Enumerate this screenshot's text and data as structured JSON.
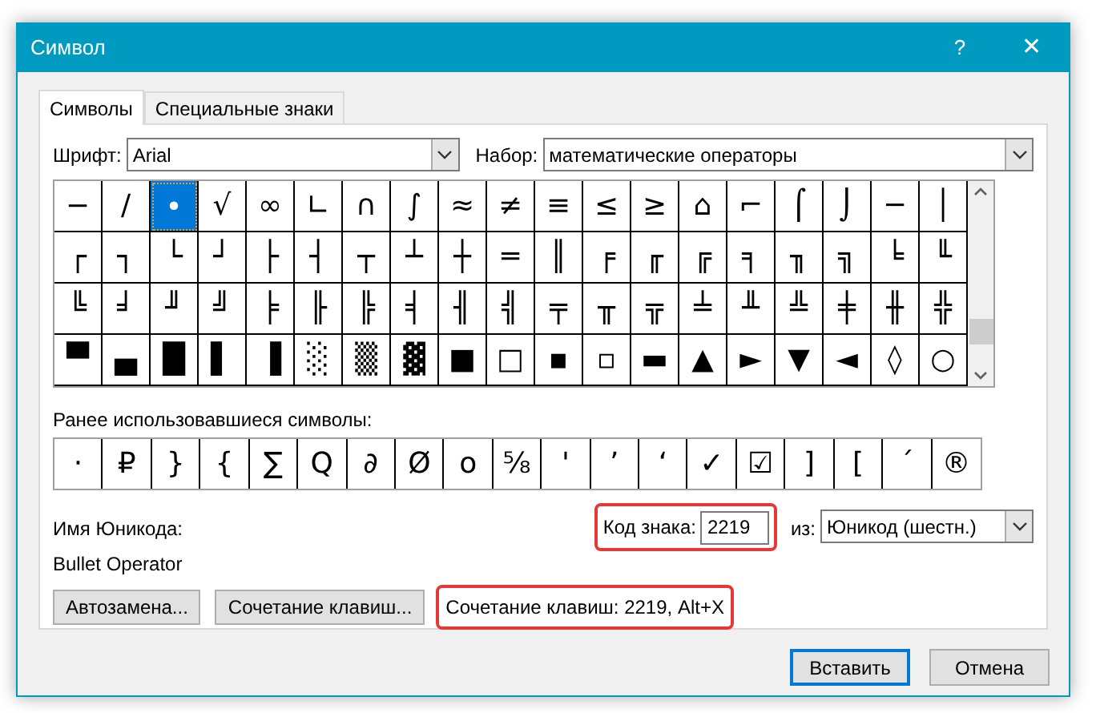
{
  "window": {
    "title": "Символ",
    "help": "?",
    "close": "✕"
  },
  "tabs": [
    {
      "label": "Символы",
      "selected": true
    },
    {
      "label": "Специальные знаки",
      "selected": false
    }
  ],
  "font": {
    "label": "Шрифт:",
    "value": "Arial"
  },
  "subset": {
    "label": "Набор:",
    "value": "математические операторы"
  },
  "symbols": [
    [
      {
        "char": "−",
        "selected": false
      },
      {
        "char": "∕",
        "selected": false
      },
      {
        "char": "∙",
        "selected": true
      },
      {
        "char": "√",
        "selected": false
      },
      {
        "char": "∞",
        "selected": false
      },
      {
        "char": "∟",
        "selected": false
      },
      {
        "char": "∩",
        "selected": false
      },
      {
        "char": "∫",
        "selected": false
      },
      {
        "char": "≈",
        "selected": false
      },
      {
        "char": "≠",
        "selected": false
      },
      {
        "char": "≡",
        "selected": false
      },
      {
        "char": "≤",
        "selected": false
      },
      {
        "char": "≥",
        "selected": false
      },
      {
        "char": "⌂",
        "selected": false
      },
      {
        "char": "⌐",
        "selected": false
      },
      {
        "char": "⌠",
        "selected": false
      },
      {
        "char": "⌡",
        "selected": false
      },
      {
        "char": "─",
        "selected": false
      },
      {
        "char": "│",
        "selected": false
      }
    ],
    [
      {
        "char": "┌",
        "selected": false
      },
      {
        "char": "┐",
        "selected": false
      },
      {
        "char": "└",
        "selected": false
      },
      {
        "char": "┘",
        "selected": false
      },
      {
        "char": "├",
        "selected": false
      },
      {
        "char": "┤",
        "selected": false
      },
      {
        "char": "┬",
        "selected": false
      },
      {
        "char": "┴",
        "selected": false
      },
      {
        "char": "┼",
        "selected": false
      },
      {
        "char": "═",
        "selected": false
      },
      {
        "char": "║",
        "selected": false
      },
      {
        "char": "╒",
        "selected": false
      },
      {
        "char": "╓",
        "selected": false
      },
      {
        "char": "╔",
        "selected": false
      },
      {
        "char": "╕",
        "selected": false
      },
      {
        "char": "╖",
        "selected": false
      },
      {
        "char": "╗",
        "selected": false
      },
      {
        "char": "╘",
        "selected": false
      },
      {
        "char": "╙",
        "selected": false
      }
    ],
    [
      {
        "char": "╚",
        "selected": false
      },
      {
        "char": "╛",
        "selected": false
      },
      {
        "char": "╜",
        "selected": false
      },
      {
        "char": "╝",
        "selected": false
      },
      {
        "char": "╞",
        "selected": false
      },
      {
        "char": "╟",
        "selected": false
      },
      {
        "char": "╠",
        "selected": false
      },
      {
        "char": "╡",
        "selected": false
      },
      {
        "char": "╢",
        "selected": false
      },
      {
        "char": "╣",
        "selected": false
      },
      {
        "char": "╤",
        "selected": false
      },
      {
        "char": "╥",
        "selected": false
      },
      {
        "char": "╦",
        "selected": false
      },
      {
        "char": "╧",
        "selected": false
      },
      {
        "char": "╨",
        "selected": false
      },
      {
        "char": "╩",
        "selected": false
      },
      {
        "char": "╪",
        "selected": false
      },
      {
        "char": "╫",
        "selected": false
      },
      {
        "char": "╬",
        "selected": false
      }
    ],
    [
      {
        "char": "▀",
        "selected": false
      },
      {
        "char": "▄",
        "selected": false
      },
      {
        "char": "█",
        "selected": false
      },
      {
        "char": "▌",
        "selected": false
      },
      {
        "char": "▐",
        "selected": false
      },
      {
        "char": "░",
        "selected": false
      },
      {
        "char": "▒",
        "selected": false
      },
      {
        "char": "▓",
        "selected": false
      },
      {
        "char": "■",
        "selected": false
      },
      {
        "char": "□",
        "selected": false
      },
      {
        "char": "▪",
        "selected": false
      },
      {
        "char": "▫",
        "selected": false
      },
      {
        "char": "▬",
        "selected": false
      },
      {
        "char": "▲",
        "selected": false
      },
      {
        "char": "►",
        "selected": false
      },
      {
        "char": "▼",
        "selected": false
      },
      {
        "char": "◄",
        "selected": false
      },
      {
        "char": "◊",
        "selected": false
      },
      {
        "char": "○",
        "selected": false
      }
    ]
  ],
  "recent": {
    "label": "Ранее использовавшиеся символы:",
    "symbols": [
      "·",
      "₽",
      "}",
      "{",
      "∑",
      "Ԛ",
      "∂",
      "Ø",
      "o",
      "⅝",
      "'",
      "’",
      "‘",
      "✓",
      "☑",
      "]",
      "[",
      "´",
      "®"
    ]
  },
  "unicode_name": {
    "label": "Имя Юникода:",
    "value": "Bullet Operator"
  },
  "char_code": {
    "label": "Код знака:",
    "value": "2219",
    "highlighted": true
  },
  "from": {
    "label": "из:",
    "value": "Юникод (шестн.)"
  },
  "buttons": [
    "Автозамена...",
    "Сочетание клавиш..."
  ],
  "shortcut": {
    "text": "Сочетание клавиш: 2219, Alt+X",
    "highlighted": true
  },
  "footer_buttons": [
    {
      "label": "Вставить",
      "default": true
    },
    {
      "label": "Отмена",
      "default": false
    }
  ]
}
